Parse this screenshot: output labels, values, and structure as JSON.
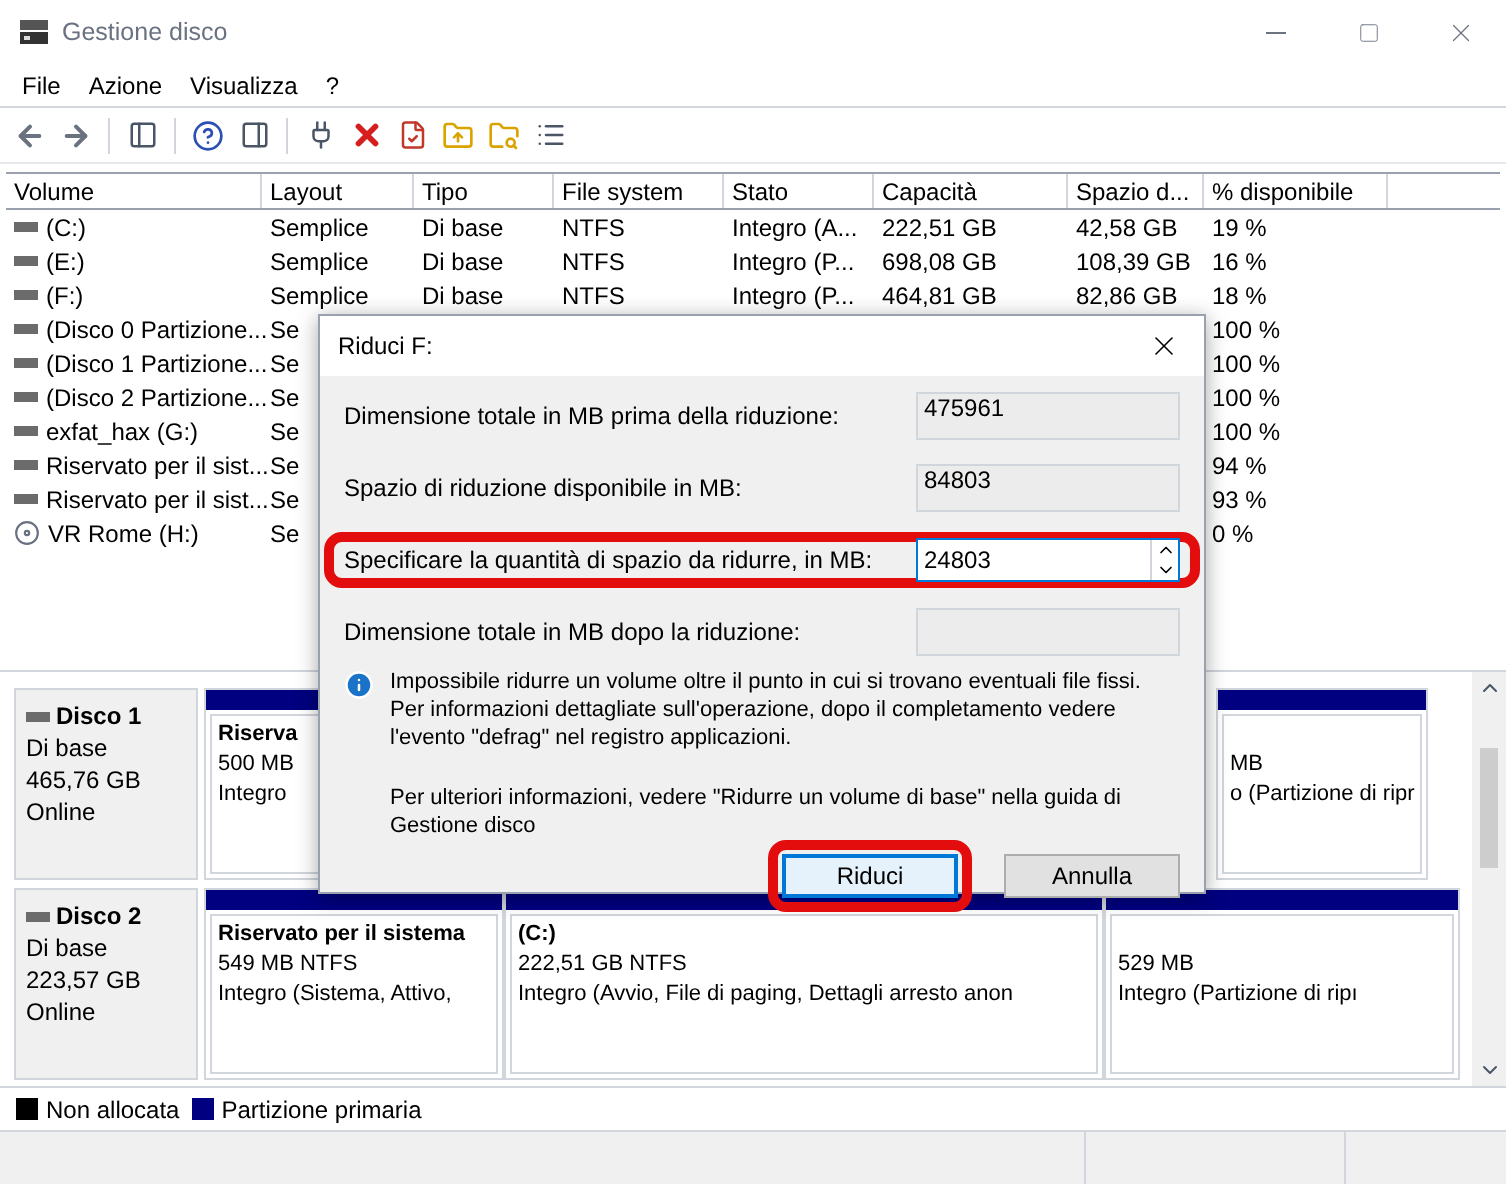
{
  "window": {
    "title": "Gestione disco"
  },
  "menu": [
    "File",
    "Azione",
    "Visualizza",
    "?"
  ],
  "table": {
    "columns": [
      "Volume",
      "Layout",
      "Tipo",
      "File system",
      "Stato",
      "Capacità",
      "Spazio d...",
      "% disponibile"
    ],
    "rows": [
      {
        "kind": "disk",
        "volume": "(C:)",
        "layout": "Semplice",
        "tipo": "Di base",
        "file_system": "NTFS",
        "stato": "Integro (A...",
        "capacita": "222,51 GB",
        "spazio": "42,58 GB",
        "percent": "19 %"
      },
      {
        "kind": "disk",
        "volume": "(E:)",
        "layout": "Semplice",
        "tipo": "Di base",
        "file_system": "NTFS",
        "stato": "Integro (P...",
        "capacita": "698,08 GB",
        "spazio": "108,39 GB",
        "percent": "16 %"
      },
      {
        "kind": "disk",
        "volume": "(F:)",
        "layout": "Semplice",
        "tipo": "Di base",
        "file_system": "NTFS",
        "stato": "Integro (P...",
        "capacita": "464,81 GB",
        "spazio": "82,86 GB",
        "percent": "18 %"
      },
      {
        "kind": "disk",
        "volume": "(Disco 0 Partizione...",
        "layout": "Se",
        "percent": "100 %"
      },
      {
        "kind": "disk",
        "volume": "(Disco 1 Partizione...",
        "layout": "Se",
        "percent": "100 %"
      },
      {
        "kind": "disk",
        "volume": "(Disco 2 Partizione...",
        "layout": "Se",
        "percent": "100 %"
      },
      {
        "kind": "disk",
        "volume": "exfat_hax (G:)",
        "layout": "Se",
        "percent": "100 %"
      },
      {
        "kind": "disk",
        "volume": "Riservato per il sist...",
        "layout": "Se",
        "percent": "94 %"
      },
      {
        "kind": "disk",
        "volume": "Riservato per il sist...",
        "layout": "Se",
        "percent": "93 %"
      },
      {
        "kind": "optical",
        "volume": "VR Rome (H:)",
        "layout": "Se",
        "percent": "0 %"
      }
    ]
  },
  "disks": [
    {
      "name": "Disco 1",
      "type": "Di base",
      "size": "465,76 GB",
      "status": "Online",
      "partitions": [
        {
          "name": "Riserva",
          "size": "500 MB",
          "state": "Integro"
        },
        {
          "size": "MB",
          "state": "o (Partizione di ripr"
        }
      ]
    },
    {
      "name": "Disco 2",
      "type": "Di base",
      "size": "223,57 GB",
      "status": "Online",
      "partitions": [
        {
          "name": "Riservato per il sistema",
          "size": "549 MB NTFS",
          "state": "Integro (Sistema, Attivo,"
        },
        {
          "name": "(C:)",
          "size": "222,51 GB NTFS",
          "state": "Integro (Avvio, File di paging, Dettagli arresto anon"
        },
        {
          "size": "529 MB",
          "state": "Integro (Partizione di ripı"
        }
      ]
    }
  ],
  "legend": [
    {
      "label": "Non allocata",
      "color": "#000000"
    },
    {
      "label": "Partizione primaria",
      "color": "#000080"
    }
  ],
  "dialog": {
    "title": "Riduci F:",
    "fields": [
      {
        "kind": "readonly",
        "label": "Dimensione totale in MB prima della riduzione:",
        "value": "475961",
        "highlighted": false
      },
      {
        "kind": "readonly",
        "label": "Spazio di riduzione disponibile in MB:",
        "value": "84803",
        "highlighted": false
      },
      {
        "kind": "spin",
        "label": "Specificare la quantità di spazio da ridurre, in MB:",
        "value": "24803",
        "highlighted": true
      },
      {
        "kind": "readonly",
        "label": "Dimensione totale in MB dopo la riduzione:",
        "highlighted": false
      }
    ],
    "info": "Impossibile ridurre un volume oltre il punto in cui si trovano eventuali file fissi. Per informazioni dettagliate sull'operazione, dopo il completamento vedere l'evento \"defrag\" nel registro applicazioni.",
    "more": "Per ulteriori informazioni, vedere \"Ridurre un volume di base\" nella guida di Gestione disco",
    "buttons": [
      {
        "label": "Riduci",
        "default": true,
        "highlighted": true
      },
      {
        "label": "Annulla",
        "default": false,
        "highlighted": false
      }
    ]
  }
}
